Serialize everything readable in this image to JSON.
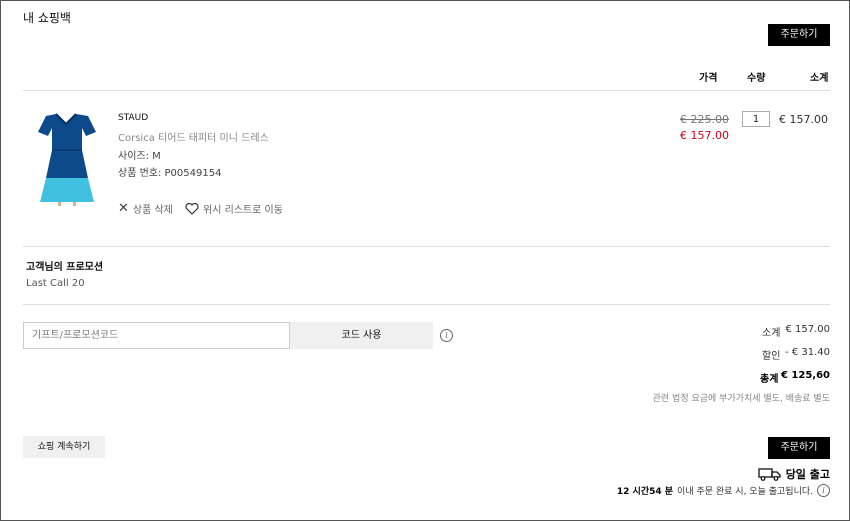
{
  "page": {
    "title": "내 쇼핑백"
  },
  "actions": {
    "order_top": "주문하기",
    "order_bottom": "주문하기",
    "continue_shopping": "쇼핑 계속하기"
  },
  "table_headers": {
    "price": "가격",
    "quantity": "수량",
    "subtotal": "소계"
  },
  "item": {
    "brand": "STAUD",
    "name": "Corsica 티어드 태피터 미니 드레스",
    "size": "사이즈: M",
    "product_no": "상품 번호: P00549154",
    "remove_label": "상품 삭제",
    "wishlist_label": "위시 리스트로 이동",
    "original_price": "€ 225.00",
    "sale_price": "€ 157.00",
    "quantity": "1",
    "line_subtotal": "€ 157.00"
  },
  "promotion": {
    "heading": "고객님의 프로모션",
    "value": "Last Call 20"
  },
  "coupon": {
    "placeholder": "기프트/프로모션코드",
    "apply_label": "코드 사용"
  },
  "summary": {
    "subtotal_label": "소계",
    "subtotal_value": "€ 157.00",
    "discount_label": "할인",
    "discount_value": "- € 31.40",
    "total_label": "총계",
    "total_value": "€ 125,60",
    "note": "관련 법정 요금에 부가가치세 별도, 배송료 별도"
  },
  "shipping": {
    "label": "당일 출고",
    "time": "12 시간54 분",
    "message": "이내 주문 완료 시, 오늘 출고됩니다."
  },
  "colors": {
    "sale": "#d0021b",
    "primary_button": "#000000",
    "dress_dark": "#0d4a8c",
    "dress_light": "#41c1e0"
  }
}
